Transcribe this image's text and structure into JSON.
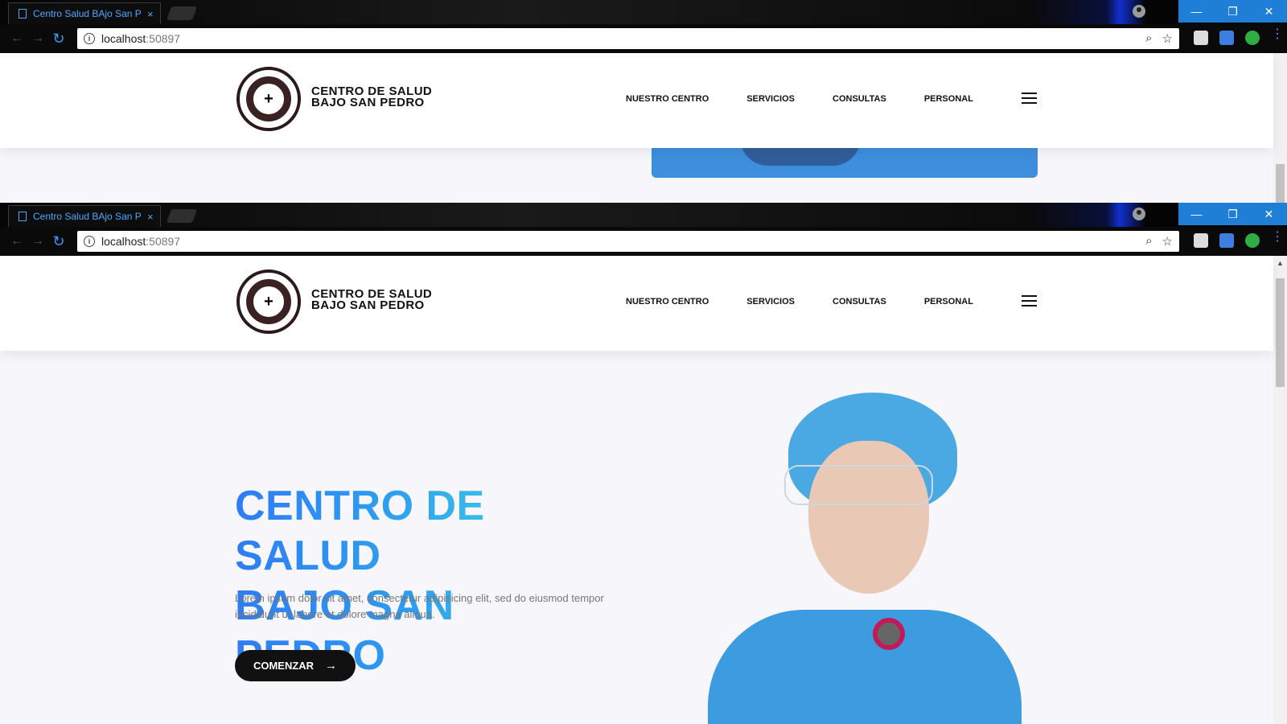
{
  "browser": {
    "tab_title": "Centro Salud BAjo San Pe",
    "tab_close": "×",
    "url_host": "localhost",
    "url_port": ":50897",
    "window_controls": [
      "—",
      "❐",
      "✕"
    ]
  },
  "site": {
    "brand_line1": "CENTRO DE SALUD",
    "brand_line2": "BAJO SAN PEDRO",
    "nav": [
      "NUESTRO CENTRO",
      "SERVICIOS",
      "CONSULTAS",
      "PERSONAL"
    ]
  },
  "hero": {
    "title_line1": "CENTRO DE SALUD",
    "title_line2": "BAJO SAN PEDRO",
    "text": "Lorem ipsum dolor sit amet, consectetur adipisicing elit, sed do eiusmod tempor incididunt ut labore et dolore magna aliqua.",
    "cta_label": "COMENZAR",
    "cta_arrow": "→"
  },
  "colors": {
    "accent_blue": "#2e7cf6",
    "accent_cyan": "#45e2e0",
    "chrome_blue": "#1f7fd6"
  }
}
